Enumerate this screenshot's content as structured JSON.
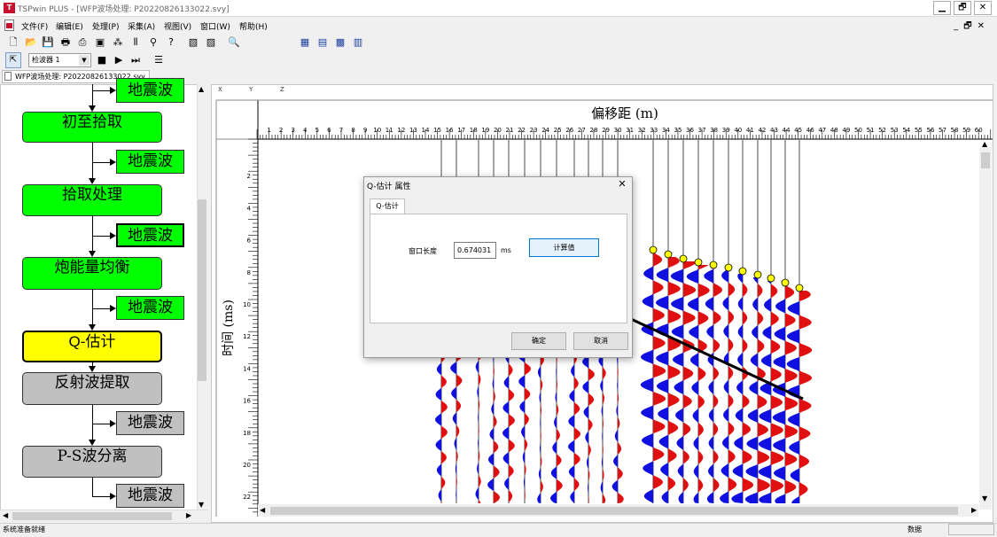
{
  "window": {
    "title": "TSPwin PLUS - [WFP波场处理: P20220826133022.svy]",
    "app_icon": "tsp-logo-icon",
    "buttons": [
      "minimize-icon",
      "restore-icon",
      "close-icon"
    ]
  },
  "menu": [
    "文件(F)",
    "编辑(E)",
    "处理(P)",
    "采集(A)",
    "视图(V)",
    "窗口(W)",
    "帮助(H)"
  ],
  "mdi_controls": [
    "_",
    "🗗",
    "✕"
  ],
  "toolbar1": [
    "new-icon",
    "open-icon",
    "save-icon",
    "print-icon",
    "print-preview-icon",
    "window-icon",
    "layers-icon",
    "columns-icon",
    "wand-icon",
    "help-icon",
    "image-icon",
    "image-red-icon",
    "zoom-icon",
    "chart-icon",
    "grid-icon",
    "image-blue-icon",
    "export-icon"
  ],
  "toolbar2": {
    "selector_value": "检波器 1",
    "buttons": [
      "stop-icon",
      "play-icon",
      "fast-forward-icon",
      "list-icon"
    ]
  },
  "doc_tab": "WFP波场处理: P20220826133022.svy",
  "flow": {
    "nodes": [
      {
        "label": "地震波",
        "kind": "green"
      },
      {
        "label": "初至拾取",
        "kind": "green"
      },
      {
        "label": "地震波",
        "kind": "green"
      },
      {
        "label": "拾取处理",
        "kind": "green"
      },
      {
        "label": "地震波",
        "kind": "green"
      },
      {
        "label": "炮能量均衡",
        "kind": "green"
      },
      {
        "label": "地震波",
        "kind": "green"
      },
      {
        "label": "Q-估计",
        "kind": "yellow"
      },
      {
        "label": "反射波提取",
        "kind": "gray"
      },
      {
        "label": "地震波",
        "kind": "gray"
      },
      {
        "label": "P-S波分离",
        "kind": "gray"
      },
      {
        "label": "地震波",
        "kind": "gray"
      }
    ]
  },
  "plot": {
    "axis_tabs": [
      "X",
      "Y",
      "Z"
    ],
    "x_title": "偏移距 (m)",
    "y_title": "时间 (ms)",
    "x_ticks": [
      "1",
      "2",
      "3",
      "4",
      "5",
      "6",
      "7",
      "8",
      "9",
      "10",
      "11",
      "12",
      "13",
      "14",
      "15",
      "16",
      "17",
      "18",
      "19",
      "20",
      "21",
      "22",
      "23",
      "24",
      "25",
      "26",
      "27",
      "28",
      "29",
      "30",
      "31",
      "32",
      "33",
      "34",
      "35",
      "36",
      "37",
      "38",
      "39",
      "40",
      "41",
      "42",
      "43",
      "44",
      "45",
      "46",
      "47",
      "48",
      "49",
      "50",
      "51",
      "52",
      "53",
      "54",
      "55",
      "56",
      "57",
      "58",
      "59",
      "60"
    ],
    "y_ticks": [
      "2",
      "4",
      "6",
      "8",
      "10",
      "12",
      "14",
      "16",
      "18",
      "20",
      "22"
    ],
    "colors": {
      "positive": "#e01010",
      "negative": "#1010e0",
      "pick": "#ffff00"
    }
  },
  "dialog": {
    "title": "Q-估计 属性",
    "tab": "Q-估计",
    "window_length_label": "窗口长度",
    "window_length_value": "0.674031",
    "unit": "ms",
    "calc_button": "计算值",
    "ok": "确定",
    "cancel": "取消"
  },
  "status": {
    "text": "系统准备就绪",
    "data_label": "数据"
  }
}
